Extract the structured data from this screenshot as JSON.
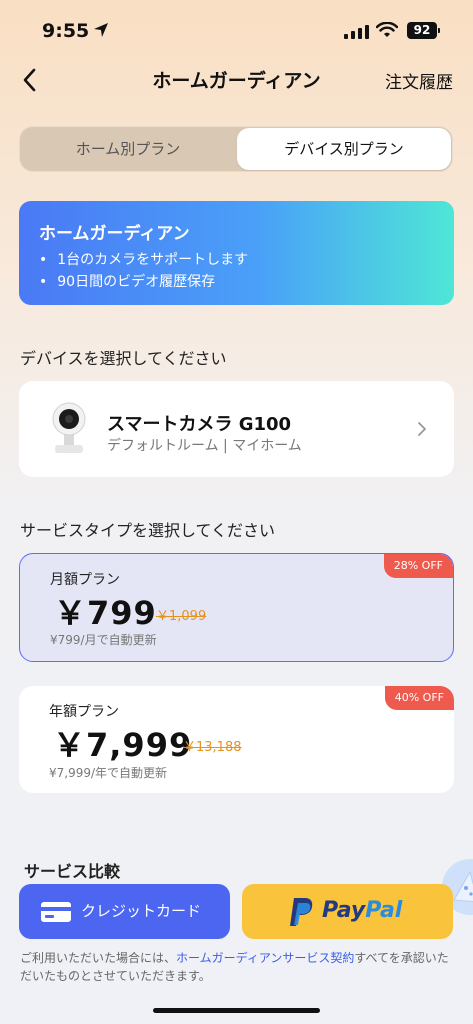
{
  "status_bar": {
    "time": "9:55",
    "battery": "92"
  },
  "nav": {
    "title": "ホームガーディアン",
    "orders_label": "注文履歴"
  },
  "segments": {
    "left": "ホーム別プラン",
    "right": "デバイス別プラン",
    "selected": "right"
  },
  "banner": {
    "title": "ホームガーディアン",
    "items": [
      "1台のカメラをサポートします",
      "90日間のビデオ履歴保存"
    ]
  },
  "device_section": {
    "title": "デバイスを選択してください",
    "device_name": "スマートカメラ G100",
    "device_location": "デフォルトルーム | マイホーム"
  },
  "service_section": {
    "title": "サービスタイプを選択してください"
  },
  "plans": [
    {
      "name": "月額プラン",
      "price": "￥799",
      "old_price": "￥1,099",
      "note": "¥799/月で自動更新",
      "badge": "28% OFF",
      "selected": true
    },
    {
      "name": "年額プラン",
      "price": "￥7,999",
      "old_price": "￥13,188",
      "note": "¥7,999/年で自動更新",
      "badge": "40% OFF",
      "selected": false
    }
  ],
  "compare": {
    "title": "サービス比較"
  },
  "payment": {
    "card_label": "クレジットカード",
    "paypal_part1": "Pay",
    "paypal_part2": "Pal"
  },
  "legal": {
    "prefix": "ご利用いただいた場合には、",
    "link": "ホームガーディアンサービス契約",
    "suffix": "すべてを承認いただいたものとさせていただきます。"
  },
  "colors": {
    "accent": "#4d66f1",
    "badge": "#ef5a4e",
    "strike": "#e8921e",
    "paypal_bg": "#fac33c"
  }
}
